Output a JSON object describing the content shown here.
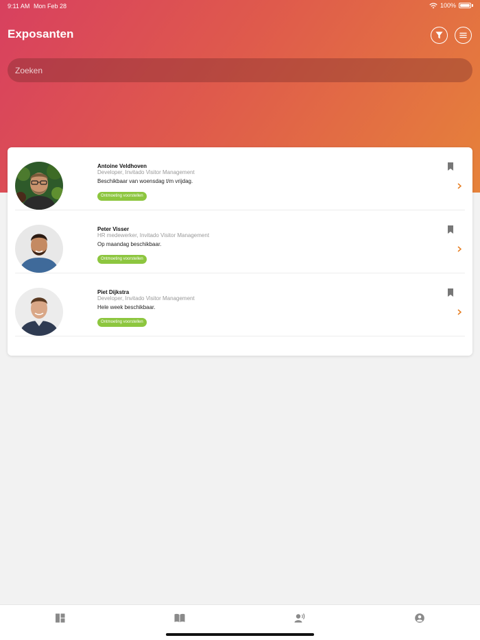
{
  "status_bar": {
    "time": "9:11 AM",
    "date": "Mon Feb 28",
    "battery": "100%"
  },
  "header": {
    "title": "Exposanten",
    "filter_icon": "filter-icon",
    "menu_icon": "menu-icon"
  },
  "search": {
    "placeholder": "Zoeken",
    "value": ""
  },
  "exhibitors": [
    {
      "name": "Antoine Veldhoven",
      "role": "Developer, Invitado Visitor Management",
      "availability": "Beschikbaar van woensdag t/m vrijdag.",
      "action": "Ontmoeting voorstellen"
    },
    {
      "name": "Peter Visser",
      "role": "HR medewerker, Invitado Visitor Management",
      "availability": "Op maandag beschikbaar.",
      "action": "Ontmoeting voorstellen"
    },
    {
      "name": "Piet Dijkstra",
      "role": "Developer, Invitado Visitor Management",
      "availability": "Hele week beschikbaar.",
      "action": "Ontmoeting voorstellen"
    }
  ],
  "tabbar": {
    "tabs": [
      "dashboard-icon",
      "book-icon",
      "speaker-icon",
      "profile-icon"
    ]
  },
  "colors": {
    "gradient_start": "#d8405f",
    "gradient_end": "#e6823a",
    "accent_green": "#8dc63f",
    "chevron_orange": "#e67e22"
  }
}
